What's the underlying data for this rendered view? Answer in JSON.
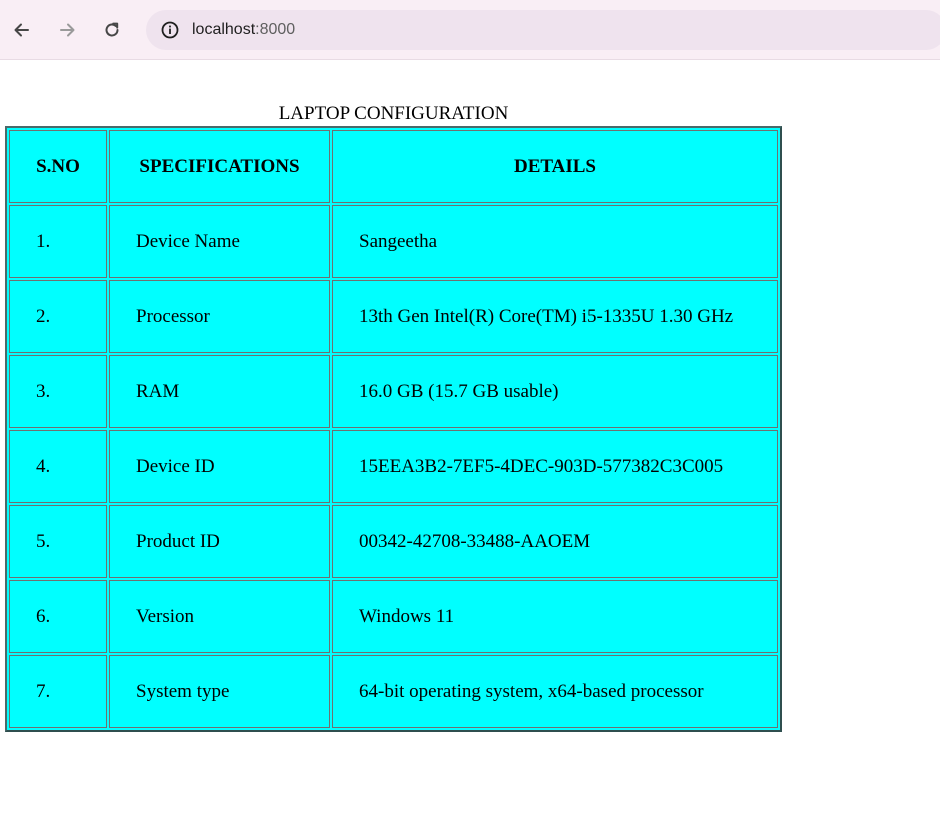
{
  "browser": {
    "url_host": "localhost",
    "url_port": ":8000"
  },
  "table": {
    "caption": "LAPTOP CONFIGURATION",
    "headers": {
      "sno": "S.NO",
      "spec": "SPECIFICATIONS",
      "details": "DETAILS"
    },
    "rows": [
      {
        "sno": "1.",
        "spec": "Device Name",
        "details": "Sangeetha"
      },
      {
        "sno": "2.",
        "spec": "Processor",
        "details": "13th Gen Intel(R) Core(TM) i5-1335U 1.30 GHz"
      },
      {
        "sno": "3.",
        "spec": "RAM",
        "details": "16.0 GB (15.7 GB usable)"
      },
      {
        "sno": "4.",
        "spec": "Device ID",
        "details": "15EEA3B2-7EF5-4DEC-903D-577382C3C005"
      },
      {
        "sno": "5.",
        "spec": "Product ID",
        "details": "00342-42708-33488-AAOEM"
      },
      {
        "sno": "6.",
        "spec": "Version",
        "details": "Windows 11"
      },
      {
        "sno": "7.",
        "spec": "System type",
        "details": "64-bit operating system, x64-based processor"
      }
    ],
    "background_color": "#00ffff"
  }
}
